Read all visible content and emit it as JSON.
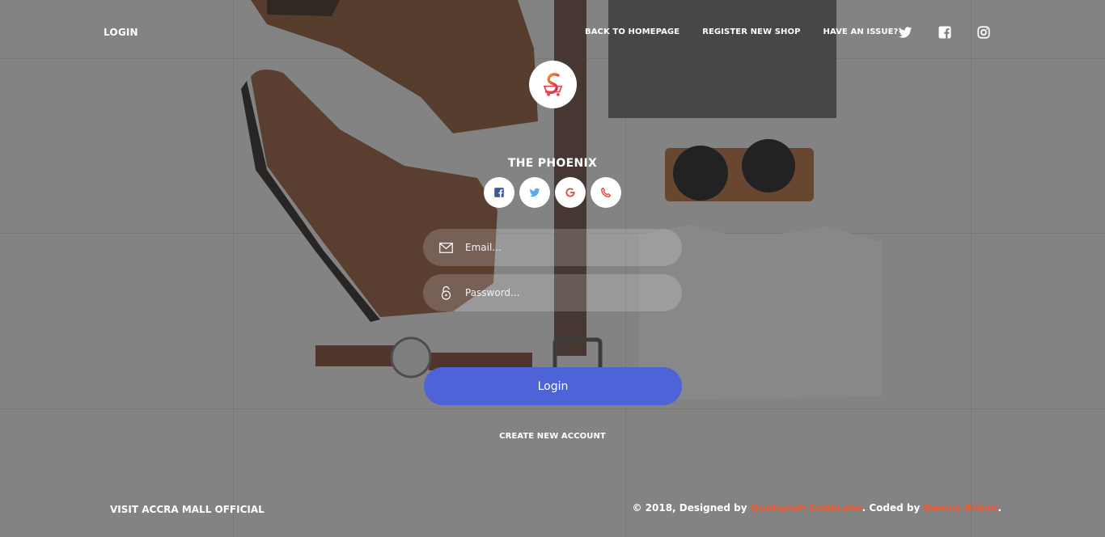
{
  "topnav": {
    "login_label": "LOGIN",
    "links": [
      "BACK TO HOMEPAGE",
      "REGISTER NEW SHOP",
      "HAVE AN ISSUE?"
    ],
    "social_icons": [
      "twitter-icon",
      "facebook-icon",
      "instagram-icon"
    ]
  },
  "brand": {
    "name": "THE PHOENIX",
    "logo_icon": "phoenix-logo",
    "social_buttons": [
      "facebook-icon",
      "twitter-icon",
      "google-icon",
      "phone-icon"
    ]
  },
  "form": {
    "email_placeholder": "Email...",
    "password_placeholder": "Password...",
    "login_label": "Login",
    "create_account_label": "CREATE NEW ACCOUNT"
  },
  "footer": {
    "left_text": "VISIT ACCRA MALL OFFICIAL",
    "copyright_prefix": "© 2018, Designed by ",
    "designer": "Quabynah CodeLabs",
    "coded_by": ". Coded by ",
    "coder": "Dennis Bilson",
    "suffix": "."
  },
  "colors": {
    "accent": "#4e63d8",
    "highlight": "#f0592e",
    "social_facebook": "#3b5998",
    "social_twitter": "#55acee",
    "social_google": "#dd4b39",
    "social_phone": "#e8463a"
  }
}
